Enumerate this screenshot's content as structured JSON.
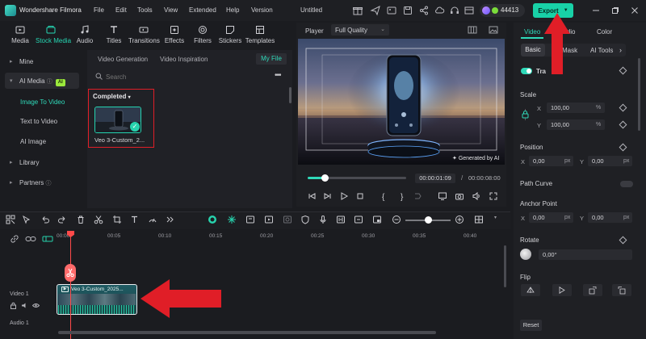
{
  "app": {
    "name": "Wondershare Filmora",
    "doc_title": "Untitled",
    "credits": "44413",
    "export_label": "Export"
  },
  "menu": [
    "File",
    "Edit",
    "Tools",
    "View",
    "Extended",
    "Help",
    "Version"
  ],
  "toolbar": [
    "Media",
    "Stock Media",
    "Audio",
    "Titles",
    "Transitions",
    "Effects",
    "Filters",
    "Stickers",
    "Templates"
  ],
  "leftnav": {
    "mine": "Mine",
    "ai_media": "AI Media",
    "ai_badge": "AI",
    "subitems": [
      "Image To Video",
      "Text to Video",
      "AI Image"
    ],
    "library": "Library",
    "partners": "Partners"
  },
  "media": {
    "tabs": [
      "Video Generation",
      "Video Inspiration"
    ],
    "my_file": "My File",
    "search_placeholder": "Search",
    "group_label": "Completed",
    "item_name": "Veo 3-Custom_2..."
  },
  "player": {
    "label": "Player",
    "quality": "Full Quality",
    "watermark": "Generated by AI",
    "time_current": "00:00:01:09",
    "time_separator": "/",
    "time_total": "00:00:08:00",
    "progress": 0.17
  },
  "props": {
    "tabs": [
      "Video",
      "Audio",
      "Color"
    ],
    "subtabs": [
      "Basic",
      "Mask",
      "AI Tools"
    ],
    "transform": "Tra",
    "scale": {
      "label": "Scale",
      "x_axis": "X",
      "x": "100,00",
      "y_axis": "Y",
      "y": "100,00",
      "unit": "%"
    },
    "position": {
      "label": "Position",
      "x_axis": "X",
      "x": "0,00",
      "y_axis": "Y",
      "y": "0,00",
      "unit": "px"
    },
    "path_curve": "Path Curve",
    "anchor": {
      "label": "Anchor Point",
      "x_axis": "X",
      "x": "0,00",
      "y_axis": "Y",
      "y": "0,00",
      "unit": "px"
    },
    "rotate": {
      "label": "Rotate",
      "value": "0,00°"
    },
    "flip": "Flip",
    "reset": "Reset"
  },
  "timeline": {
    "ticks": [
      "00:00",
      "00:05",
      "00:10",
      "00:15",
      "00:20",
      "00:25",
      "00:30",
      "00:35",
      "00:40"
    ],
    "track1": "Video 1",
    "track2": "Audio 1",
    "clip_title": "Veo 3-Custom_2025..."
  },
  "colors": {
    "accent": "#2fd9b9",
    "annotation": "#e01e27",
    "playhead": "#ff4a4a"
  }
}
